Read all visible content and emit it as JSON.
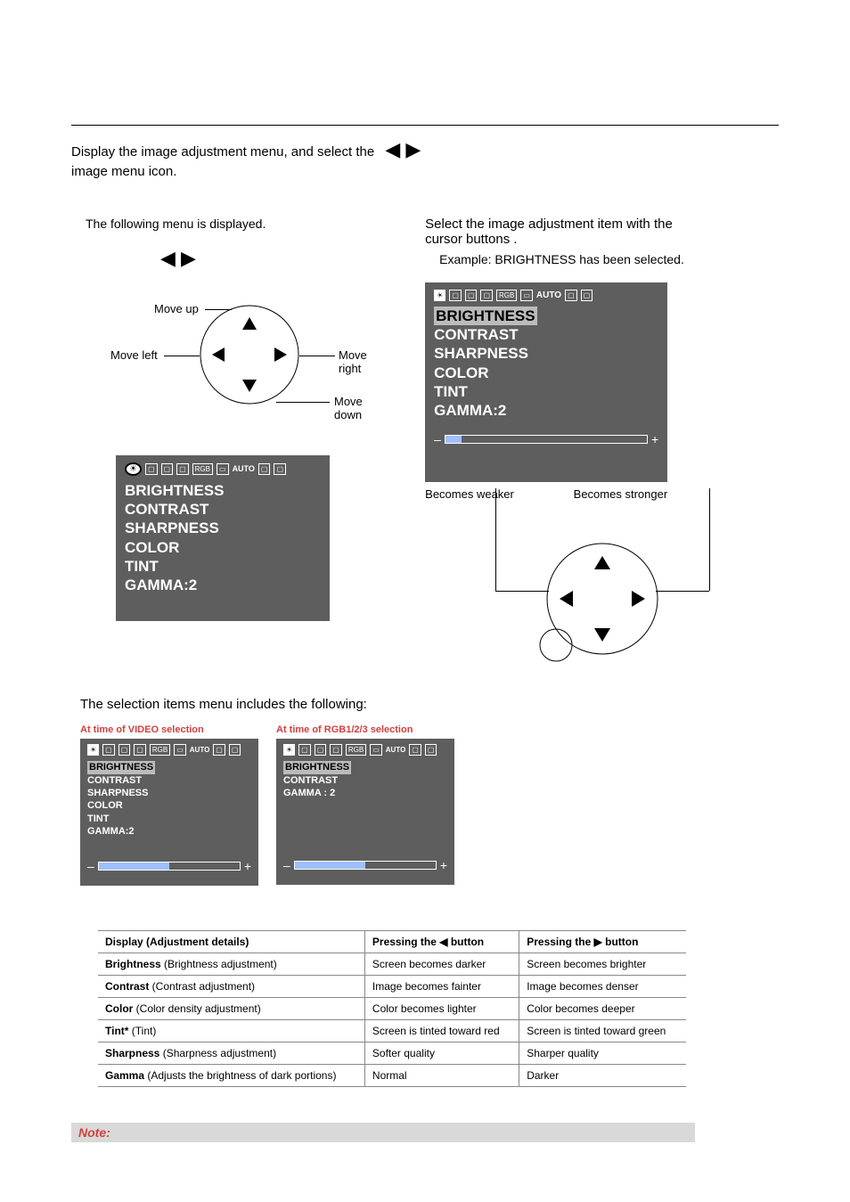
{
  "intro_line1": "Display the image adjustment menu, and select the",
  "intro_line2": "image menu icon.",
  "intro_sub": "The following menu is displayed.",
  "nav": {
    "up": "Move up",
    "down": "Move down",
    "left": "Move left",
    "right": "Move right"
  },
  "panel_menu": [
    "BRIGHTNESS",
    "CONTRAST",
    "SHARPNESS",
    "COLOR",
    "TINT",
    "GAMMA:2"
  ],
  "panel_icons": {
    "rgb": "RGB",
    "auto": "AUTO"
  },
  "step2_line1": "Select the image adjustment item with the",
  "step2_line2": "cursor buttons    .",
  "step2_sub": "Example: BRIGHTNESS has been selected.",
  "becomes_weaker": "Becomes weaker",
  "becomes_stronger": "Becomes stronger",
  "step3_text": "The selection items menu includes the following:",
  "caption_video": "At time of VIDEO selection",
  "caption_rgb": "At time of RGB1/2/3 selection",
  "rgb_menu": [
    "BRIGHTNESS",
    "CONTRAST",
    "GAMMA : 2"
  ],
  "table": {
    "head": [
      "Display  (Adjustment details)",
      "Pressing the ◀ button",
      "Pressing the ▶ button"
    ],
    "rows": [
      {
        "label": "Brightness",
        "detail": " (Brightness adjustment)",
        "l": "Screen becomes darker",
        "r": "Screen becomes brighter"
      },
      {
        "label": "Contrast",
        "detail": " (Contrast adjustment)",
        "l": "Image becomes fainter",
        "r": "Image becomes denser"
      },
      {
        "label": "Color",
        "detail": " (Color density adjustment)",
        "l": "Color becomes lighter",
        "r": "Color becomes deeper"
      },
      {
        "label": "Tint*",
        "detail": " (Tint)",
        "l": "Screen is tinted toward red",
        "r": "Screen is tinted toward green"
      },
      {
        "label": "Sharpness",
        "detail": " (Sharpness adjustment)",
        "l": "Softer quality",
        "r": "Sharper quality"
      },
      {
        "label": "Gamma",
        "detail": " (Adjusts the brightness of dark portions)",
        "l": "Normal",
        "r": "Darker"
      }
    ]
  },
  "note": "Note:"
}
